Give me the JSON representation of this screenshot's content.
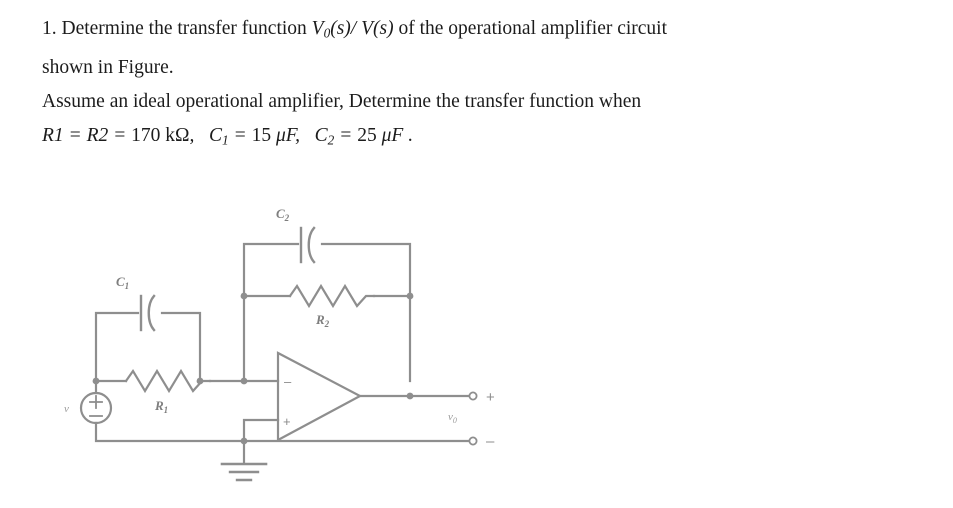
{
  "document": {
    "problem_number": "1.",
    "paragraph1_part1": "Determine the transfer function",
    "paragraph1_math": "V₀(s) / V(s)",
    "paragraph1_part2": "of the operational amplifier circuit shown in Figure.",
    "line1_text": "1. Determine the transfer function",
    "line1_math": "V0(s)/ V(s)",
    "line1_tail": "of the operational amplifier circuit",
    "line2_text": "shown in Figure.",
    "line3_text": "Assume an ideal operational amplifier, Determine the transfer function when",
    "line4_math_r": "R1 = R2 = 170 kΩ,",
    "line4_math_c1": "C₁ = 15 μF,",
    "line4_math_c2": "C₂ = 25 μF .",
    "values": {
      "R1": "170 kΩ",
      "R2": "170 kΩ",
      "C1": "15 μF",
      "C2": "25 μF"
    }
  },
  "figure": {
    "caption": "operational amplifier circuit",
    "components": [
      {
        "id": "C1",
        "label": "C",
        "sub": "1",
        "type": "capacitor"
      },
      {
        "id": "R1",
        "label": "R",
        "sub": "1",
        "type": "resistor"
      },
      {
        "id": "C2",
        "label": "C",
        "sub": "2",
        "type": "capacitor"
      },
      {
        "id": "R2",
        "label": "R",
        "sub": "2",
        "type": "resistor"
      },
      {
        "id": "SRC",
        "label": "v",
        "sub": "",
        "type": "voltage-source"
      },
      {
        "id": "VOUT",
        "label": "v",
        "sub": "0",
        "type": "output-voltage"
      },
      {
        "id": "OPAMP",
        "label": "",
        "sub": "",
        "type": "op-amp"
      },
      {
        "id": "GND",
        "label": "",
        "sub": "",
        "type": "ground"
      }
    ],
    "source_plus": "+",
    "source_minus": "−",
    "opamp_inverting": "−",
    "opamp_noninverting": "+",
    "terminal_plus": "+",
    "terminal_minus": "−",
    "vout_label": "v",
    "vout_sub": "0",
    "source_label": "v",
    "c1_label": "C",
    "c1_sub": "1",
    "c2_label": "C",
    "c2_sub": "2",
    "r1_label": "R",
    "r1_sub": "1",
    "r2_label": "R",
    "r2_sub": "2"
  },
  "colors": {
    "ink": "#1c1c1c",
    "wire": "#8c8c8c",
    "label": "#7e7e7e",
    "background": "#ffffff"
  }
}
